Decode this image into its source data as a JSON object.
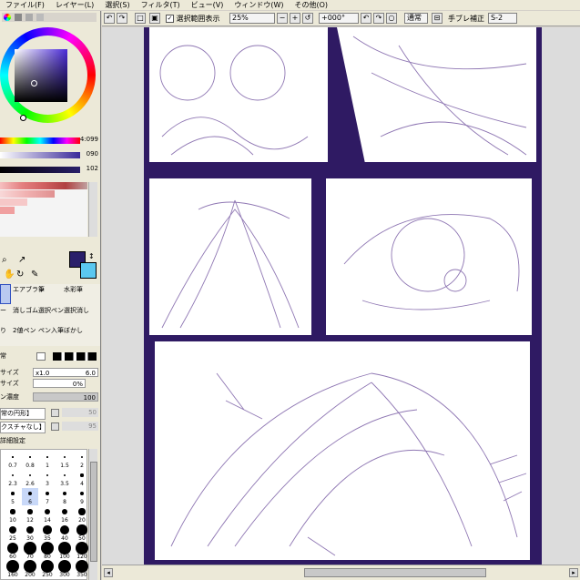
{
  "menu": [
    "ファイル(F)",
    "レイヤー(L)",
    "選択(S)",
    "フィルタ(T)",
    "ビュー(V)",
    "ウィンドウ(W)",
    "その他(O)"
  ],
  "toolbar": {
    "show_selection_label": "選択範囲表示",
    "zoom": "25%",
    "rotation": "+000°",
    "mode": "通常",
    "stabilizer_label": "手ブレ補正",
    "stabilizer_value": "S-2"
  },
  "color": {
    "slider1_value": "4:099",
    "slider2_value": "090",
    "slider3_value": "102",
    "fg": "#2a1f6a",
    "bg": "#5bc8f0"
  },
  "tools": {
    "row1": [
      "エアブラシ",
      "筆",
      "水彩筆"
    ],
    "row2": [
      "ー",
      "消しゴム",
      "選択ペン",
      "選択消し"
    ],
    "row3": [
      "り",
      "2値ペン",
      "ペン入筆",
      "ぼかし"
    ],
    "brush_blend": "常",
    "brush_size_label": "サイズ",
    "brush_size_mult": "x1.0",
    "brush_size_value": "6.0",
    "min_size_label": "サイズ",
    "min_size_value": "0%",
    "density_label": "ン濃度",
    "density_value": "100",
    "shape_label": "常の円形】",
    "shape_value": "50",
    "texture_label": "クスチャなし】",
    "texture_value": "95",
    "detail_label": "詳細設定"
  },
  "brush_sizes": {
    "row_labels": [
      [
        "0.7",
        "0.8",
        "1",
        "1.5",
        "2"
      ],
      [
        "2.3",
        "2.6",
        "3",
        "3.5",
        "4"
      ],
      [
        "5",
        "6",
        "7",
        "8",
        "9"
      ],
      [
        "10",
        "12",
        "14",
        "16",
        "20"
      ],
      [
        "25",
        "30",
        "35",
        "40",
        "50"
      ],
      [
        "60",
        "70",
        "80",
        "100",
        "120"
      ],
      [
        "160",
        "200",
        "250",
        "300",
        "350"
      ]
    ],
    "selected": "6"
  },
  "canvas": {
    "bg_color": "#2f1a63",
    "line_color": "#6a4a9a"
  }
}
